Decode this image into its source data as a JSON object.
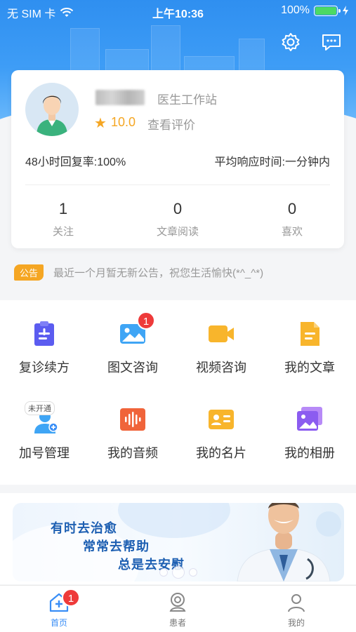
{
  "status_bar": {
    "carrier": "无 SIM 卡",
    "time": "上午10:36",
    "battery": "100%"
  },
  "profile": {
    "title": "医生工作站",
    "rating": "10.0",
    "view_reviews": "查看评价",
    "reply_rate": "48小时回复率:100%",
    "avg_response": "平均响应时间:一分钟内",
    "stats": [
      {
        "value": "1",
        "label": "关注"
      },
      {
        "value": "0",
        "label": "文章阅读"
      },
      {
        "value": "0",
        "label": "喜欢"
      }
    ]
  },
  "notice": {
    "tag": "公告",
    "text": "最近一个月暂无新公告，祝您生活愉快(*^_^*)"
  },
  "menu": [
    {
      "label": "复诊续方",
      "icon": "prescription-icon"
    },
    {
      "label": "图文咨询",
      "icon": "image-consult-icon",
      "badge": "1"
    },
    {
      "label": "视频咨询",
      "icon": "video-camera-icon"
    },
    {
      "label": "我的文章",
      "icon": "document-icon"
    },
    {
      "label": "加号管理",
      "icon": "doctor-plus-icon",
      "tag": "未开通"
    },
    {
      "label": "我的音频",
      "icon": "audio-icon"
    },
    {
      "label": "我的名片",
      "icon": "business-card-icon"
    },
    {
      "label": "我的相册",
      "icon": "album-icon"
    }
  ],
  "banner": {
    "lines": [
      "有时去治愈",
      "常常去帮助",
      "总是去安慰"
    ]
  },
  "tabbar": [
    {
      "label": "首页",
      "icon": "home-medical-icon",
      "badge": "1",
      "active": true
    },
    {
      "label": "患者",
      "icon": "patient-icon"
    },
    {
      "label": "我的",
      "icon": "user-icon"
    }
  ],
  "colors": {
    "primary": "#3a8ef6",
    "accent": "#f5a623",
    "badge": "#ee3a3a"
  }
}
